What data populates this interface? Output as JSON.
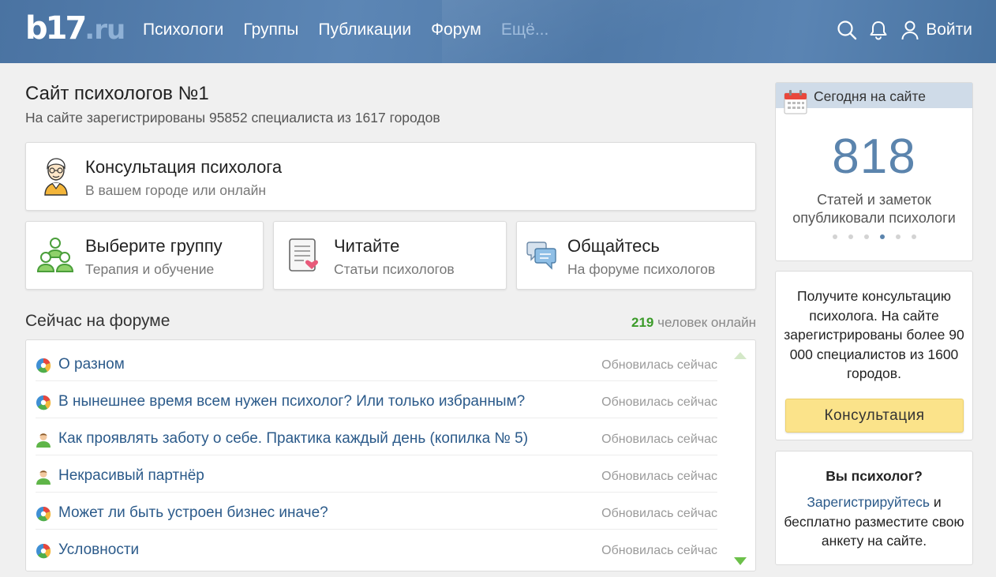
{
  "header": {
    "logo_main": "b17",
    "logo_suffix": ".ru",
    "nav": [
      {
        "label": "Психологи"
      },
      {
        "label": "Группы"
      },
      {
        "label": "Публикации"
      },
      {
        "label": "Форум"
      },
      {
        "label": "Ещё..."
      }
    ],
    "login_label": "Войти",
    "icons": [
      "search-icon",
      "bell-icon",
      "user-icon"
    ]
  },
  "main": {
    "title": "Сайт психологов №1",
    "subtitle": "На сайте зарегистрированы 95852 специалиста из 1617 городов",
    "cards": {
      "consult": {
        "title": "Консультация психолога",
        "sub": "В вашем городе или онлайн"
      },
      "group": {
        "title": "Выберите группу",
        "sub": "Терапия и обучение"
      },
      "read": {
        "title": "Читайте",
        "sub": "Статьи психологов"
      },
      "talk": {
        "title": "Общайтесь",
        "sub": "На форуме психологов"
      }
    },
    "forum": {
      "title": "Сейчас на форуме",
      "online_count": "219",
      "online_label": "человек онлайн",
      "threads": [
        {
          "title": "О разном",
          "status": "Обновилась сейчас",
          "icon": "color-wheel-icon"
        },
        {
          "title": "В нынешнее время всем нужен психолог? Или только избранным?",
          "status": "Обновилась сейчас",
          "icon": "color-wheel-icon"
        },
        {
          "title": "Как проявлять заботу о себе. Практика каждый день (копилка № 5)",
          "status": "Обновилась сейчас",
          "icon": "person-icon"
        },
        {
          "title": "Некрасивый партнёр",
          "status": "Обновилась сейчас",
          "icon": "person-icon"
        },
        {
          "title": "Может ли быть устроен бизнес иначе?",
          "status": "Обновилась сейчас",
          "icon": "color-wheel-icon"
        },
        {
          "title": "Условности",
          "status": "Обновилась сейчас",
          "icon": "color-wheel-icon"
        }
      ]
    }
  },
  "sidebar": {
    "today": {
      "title": "Сегодня на сайте",
      "count": "818",
      "line1": "Статей и заметок",
      "line2": "опубликовали психологи",
      "slides_total": 6,
      "active_slide": 4
    },
    "promo": {
      "text": "Получите консультацию психолога. На сайте зарегистрированы более 90 000 специалистов из 1600 городов.",
      "button": "Консультация"
    },
    "register": {
      "question": "Вы психолог?",
      "link": "Зарегистрируйтесь",
      "rest": "и бесплатно разместите свою анкету на сайте."
    }
  },
  "colors": {
    "header_bg": "#4f79a8",
    "link": "#2b5a8a",
    "online_green": "#3b9b29",
    "button_yellow": "#fbe38a",
    "counter_blue": "#5b84ad"
  }
}
